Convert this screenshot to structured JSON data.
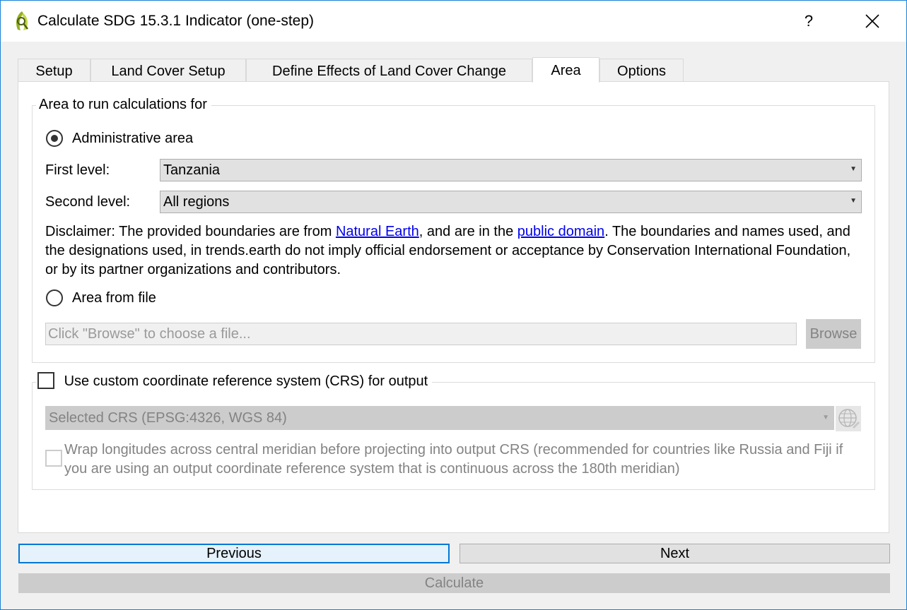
{
  "window": {
    "title": "Calculate SDG 15.3.1 Indicator (one-step)",
    "help_label": "?",
    "close_icon": "close-icon",
    "app_icon": "qgis-icon"
  },
  "tabs": [
    {
      "label": "Setup"
    },
    {
      "label": "Land Cover Setup"
    },
    {
      "label": "Define Effects of Land Cover Change"
    },
    {
      "label": "Area",
      "active": true
    },
    {
      "label": "Options"
    }
  ],
  "area_group": {
    "title": "Area to run calculations for",
    "admin_radio_label": "Administrative area",
    "admin_selected": true,
    "first_level_label": "First level:",
    "first_level_value": "Tanzania",
    "second_level_label": "Second level:",
    "second_level_value": "All regions",
    "disclaimer": {
      "part1": "Disclaimer: The provided boundaries are from ",
      "link1": "Natural Earth",
      "part2": ", and are in the ",
      "link2": "public domain",
      "part3": ". The boundaries and names used, and the designations used, in trends.earth do not imply official endorsement or acceptance by Conservation International Foundation, or by its partner organizations and contributors."
    },
    "file_radio_label": "Area from file",
    "file_selected": false,
    "file_placeholder": "Click \"Browse\" to choose a file...",
    "browse_label": "Browse"
  },
  "crs_group": {
    "checkbox_label": "Use custom coordinate reference system (CRS) for output",
    "checked": false,
    "selected_crs": "Selected CRS (EPSG:4326, WGS 84)",
    "crs_icon": "globe-icon",
    "wrap_label": "Wrap longitudes across central meridian before projecting into output CRS (recommended for countries like Russia and Fiji if you are using an output coordinate reference system that is continuous across the 180th meridian)"
  },
  "footer": {
    "previous_label": "Previous",
    "next_label": "Next",
    "calculate_label": "Calculate"
  },
  "colors": {
    "accent": "#0078d7",
    "link": "#0000ee",
    "disabled_text": "#838383"
  }
}
